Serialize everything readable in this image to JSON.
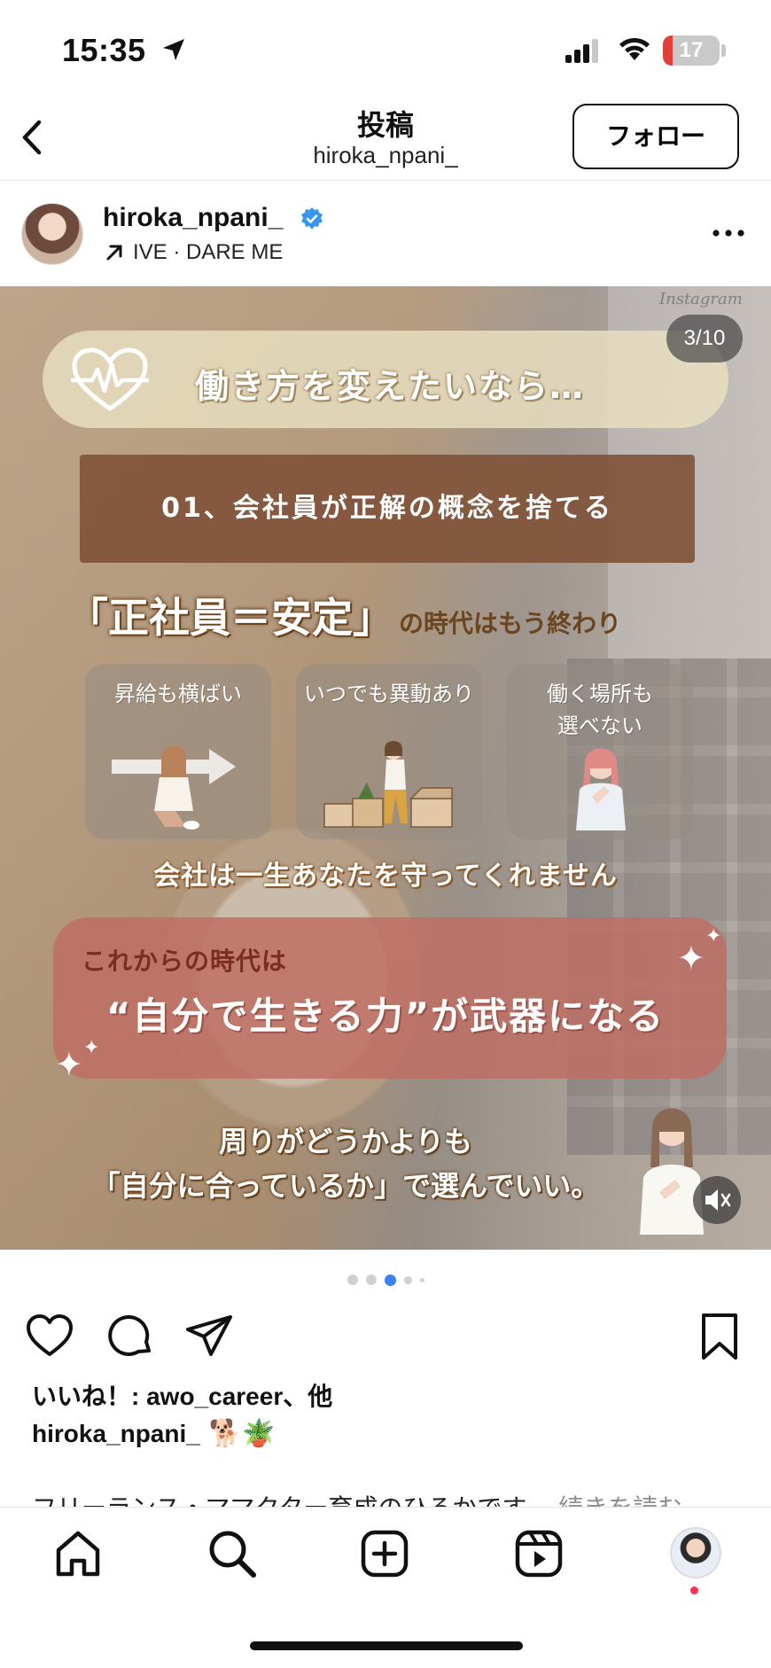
{
  "status_bar": {
    "time": "15:35",
    "battery": "17",
    "battery_fraction": 0.17,
    "icons": [
      "location-arrow-icon",
      "cellular-signal-icon",
      "wifi-icon",
      "battery-icon"
    ]
  },
  "nav": {
    "title": "投稿",
    "subtitle": "hiroka_npani_",
    "follow_label": "フォロー",
    "back_icon": "chevron-left-icon"
  },
  "post": {
    "username": "hiroka_npani_",
    "music": "IVE · DARE ME",
    "verified_icon": "verified-badge-icon",
    "more_icon": "more-horizontal-icon"
  },
  "media": {
    "watermark": "Instagram",
    "counter": "3/10",
    "title": "働き方を変えたいなら…",
    "section": "01、会社員が正解の概念を捨てる",
    "headline_big": "「正社員＝安定」",
    "headline_small": "の時代はもう終わり",
    "cards": [
      {
        "label": "昇給も横ばい"
      },
      {
        "label": "いつでも異動あり"
      },
      {
        "label": "働く場所も\n選べない"
      }
    ],
    "protect": "会社は一生あなたを守ってくれません",
    "red_sub": "これからの時代は",
    "red_main": "“自分で生きる力”が武器になる",
    "bottom_line1": "周りがどうかよりも",
    "bottom_line2": "「自分に合っているか」で選んでいい。",
    "mute_icon": "speaker-muted-icon",
    "accent_colors": {
      "brown": "#80543a",
      "rose": "#be6e64",
      "beige": "#e8dec0"
    }
  },
  "carousel": {
    "total_dots": 5,
    "active_index": 2
  },
  "actions": {
    "icons": [
      "heart-icon",
      "comment-icon",
      "send-icon",
      "bookmark-icon"
    ]
  },
  "likes": "いいね！: awo_career、他",
  "caption": {
    "username": "hiroka_npani_",
    "emoji": "🐕🪴",
    "text": "フリーランス・ママクター育成のひろかです",
    "more": "… 続きを読む"
  },
  "tabbar": {
    "icons": [
      "home-icon",
      "search-icon",
      "create-plus-icon",
      "reels-icon",
      "profile-avatar"
    ]
  }
}
